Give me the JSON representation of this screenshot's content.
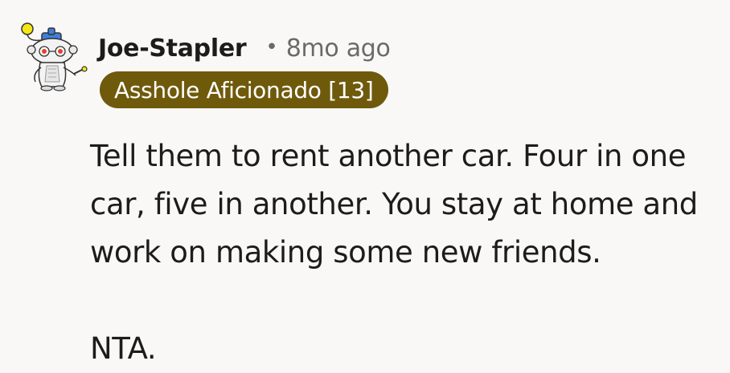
{
  "comment": {
    "username": "Joe-Stapler",
    "separator": "•",
    "timestamp": "8mo ago",
    "flair": "Asshole Aficionado [13]",
    "paragraphs": [
      "Tell them to rent another car. Four in one car, five in another. You stay at home and work on making some new friends.",
      "NTA."
    ],
    "avatar_icon": "snoo-avatar-icon"
  },
  "colors": {
    "background": "#faf8f7",
    "flair_background": "#6f5a0c",
    "flair_text": "#ffffff",
    "meta_text": "#6a6a6a"
  }
}
